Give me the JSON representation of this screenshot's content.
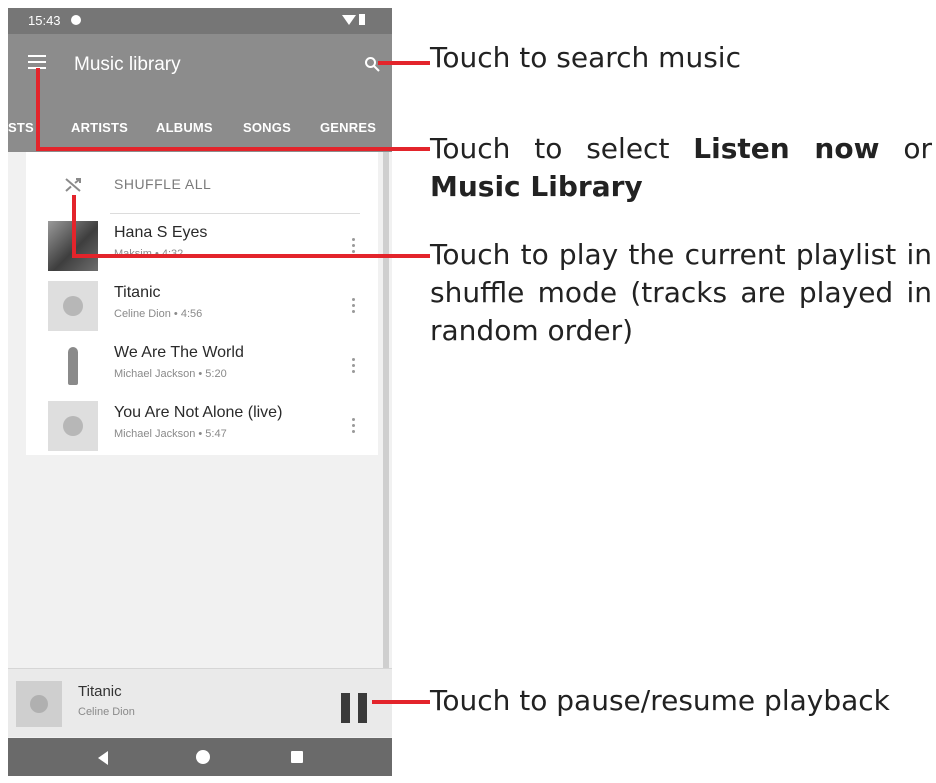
{
  "status_bar": {
    "time": "15:43"
  },
  "app_bar": {
    "title": "Music library",
    "tabs": [
      "LISTS",
      "ARTISTS",
      "ALBUMS",
      "SONGS",
      "GENRES"
    ]
  },
  "list": {
    "shuffle_label": "SHUFFLE ALL",
    "songs": [
      {
        "title": "Hana S Eyes",
        "subtitle": "Maksim • 4:32"
      },
      {
        "title": "Titanic",
        "subtitle": "Celine Dion • 4:56"
      },
      {
        "title": "We Are The World",
        "subtitle": "Michael Jackson • 5:20"
      },
      {
        "title": "You Are Not Alone (live)",
        "subtitle": "Michael Jackson • 5:47"
      }
    ]
  },
  "now_playing": {
    "title": "Titanic",
    "artist": "Celine Dion"
  },
  "annotations": {
    "search": "Touch to search music",
    "menu_pre": "Touch to select ",
    "menu_bold1": "Listen now",
    "menu_mid": " or ",
    "menu_bold2": "Music Library",
    "shuffle": "Touch to play the current playlist in shuffle mode (tracks are played in random order)",
    "pause": "Touch to pause/resume playback"
  },
  "colors": {
    "callout": "#e3242b",
    "app_bar": "#8c8c8c"
  }
}
